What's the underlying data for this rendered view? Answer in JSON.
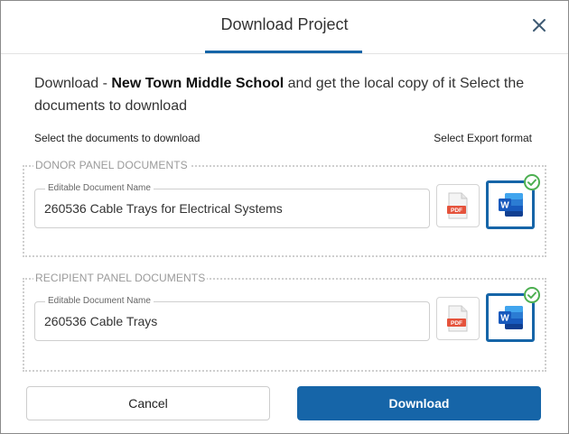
{
  "dialog": {
    "title": "Download Project",
    "intro_prefix": "Download - ",
    "project_name": "New Town Middle School",
    "intro_suffix": " and get the local copy of it Select the documents to download",
    "select_docs_label": "Select the documents to download",
    "select_format_label": "Select Export format"
  },
  "sections": [
    {
      "label": "DONOR PANEL DOCUMENTS",
      "field_label": "Editable Document Name",
      "document_name": "260536 Cable Trays for Electrical Systems",
      "selected_format": "word"
    },
    {
      "label": "RECIPIENT PANEL DOCUMENTS",
      "field_label": "Editable Document Name",
      "document_name": "260536 Cable Trays",
      "selected_format": "word"
    }
  ],
  "formats": {
    "pdf_label": "PDF",
    "word_letter": "W"
  },
  "icons": [
    "close-icon",
    "pdf-file-icon",
    "word-file-icon",
    "check-circle-icon"
  ],
  "colors": {
    "accent": "#1665a8",
    "check": "#4caf50",
    "pdf_red": "#e5533c"
  },
  "buttons": {
    "cancel": "Cancel",
    "download": "Download"
  }
}
